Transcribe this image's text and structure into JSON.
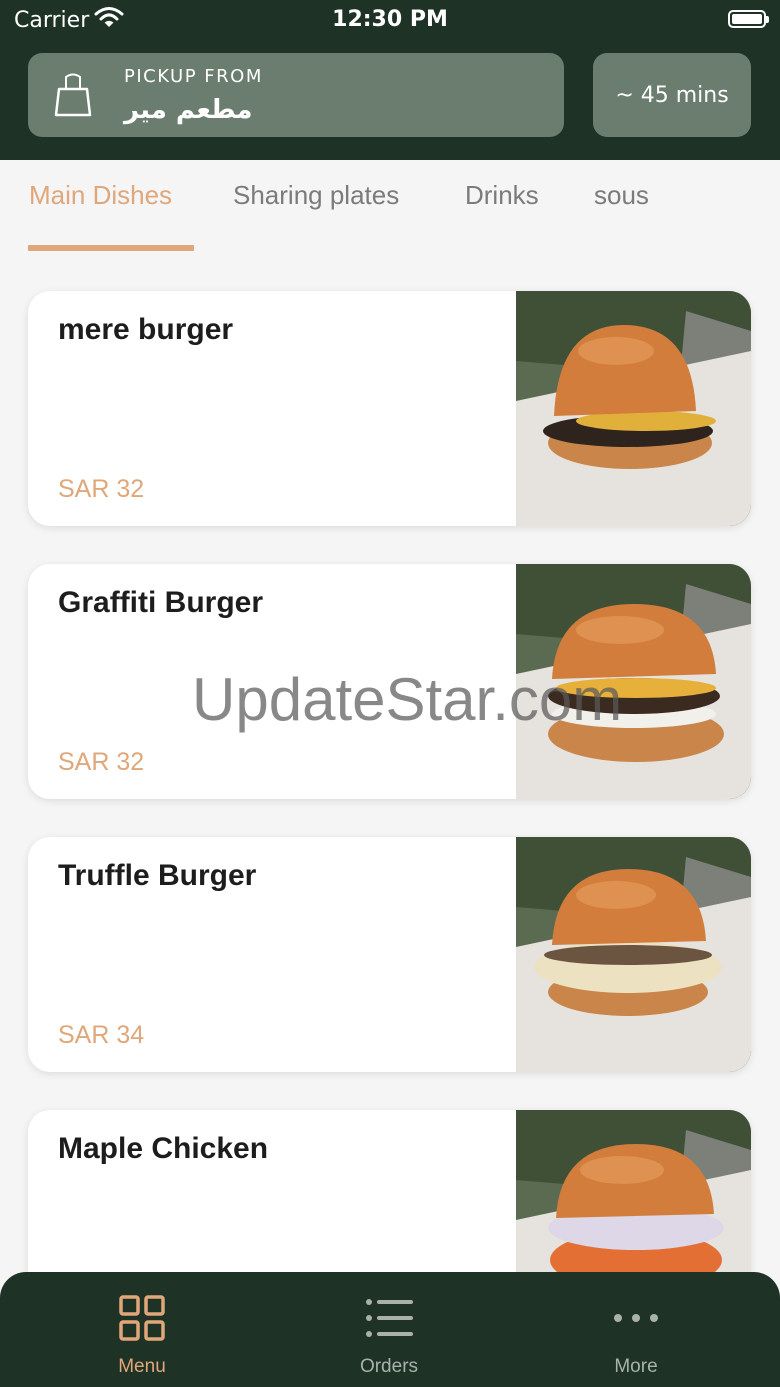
{
  "status_bar": {
    "carrier": "Carrier",
    "time": "12:30 PM"
  },
  "pickup": {
    "label": "PICKUP FROM",
    "restaurant": "مطعم مير",
    "eta": "~ 45 mins"
  },
  "tabs": [
    {
      "label": "Main Dishes",
      "active": true
    },
    {
      "label": "Sharing plates",
      "active": false
    },
    {
      "label": "Drinks",
      "active": false
    },
    {
      "label": "sous",
      "active": false
    }
  ],
  "dishes": [
    {
      "name": "mere burger",
      "price": "SAR 32"
    },
    {
      "name": "Graffiti Burger",
      "price": "SAR 32"
    },
    {
      "name": "Truffle Burger",
      "price": "SAR 34"
    },
    {
      "name": "Maple Chicken",
      "price": ""
    }
  ],
  "watermark": "UpdateStar.com",
  "bottom_nav": [
    {
      "label": "Menu",
      "icon": "grid-icon",
      "active": true
    },
    {
      "label": "Orders",
      "icon": "list-icon",
      "active": false
    },
    {
      "label": "More",
      "icon": "more-dots-icon",
      "active": false
    }
  ],
  "colors": {
    "header": "#1e3225",
    "accent": "#dfa77a",
    "card_header": "#6a7d6e"
  }
}
